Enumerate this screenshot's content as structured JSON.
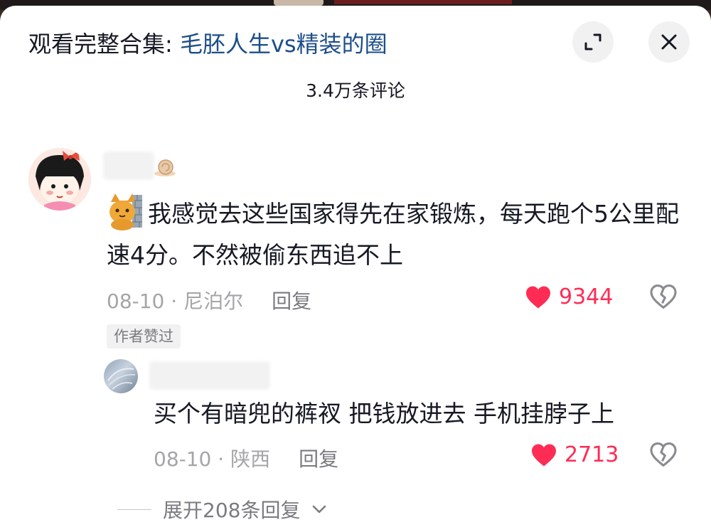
{
  "header": {
    "prefix": "观看完整合集: ",
    "collection": "毛胚人生vs精装的圈"
  },
  "comment_count": "3.4万条评论",
  "comments": [
    {
      "text": "我感觉去这些国家得先在家锻炼，每天跑个5公里配速4分。不然被偷东西追不上",
      "date": "08-10",
      "location": "尼泊尔",
      "reply_label": "回复",
      "likes": "9344",
      "author_liked": "作者赞过"
    }
  ],
  "reply": {
    "text": "买个有暗兜的裤衩  把钱放进去  手机挂脖子上",
    "date": "08-10",
    "location": "陕西",
    "reply_label": "回复",
    "likes": "2713"
  },
  "expand_replies": "展开208条回复",
  "colors": {
    "accent": "#fe2c55",
    "link": "#1c4e8a",
    "muted": "#a5a5a8"
  },
  "icons": [
    "expand-icon",
    "close-icon",
    "heart-icon",
    "broken-heart-icon",
    "chevron-down-icon",
    "snail-icon",
    "cat-badge-icon"
  ]
}
